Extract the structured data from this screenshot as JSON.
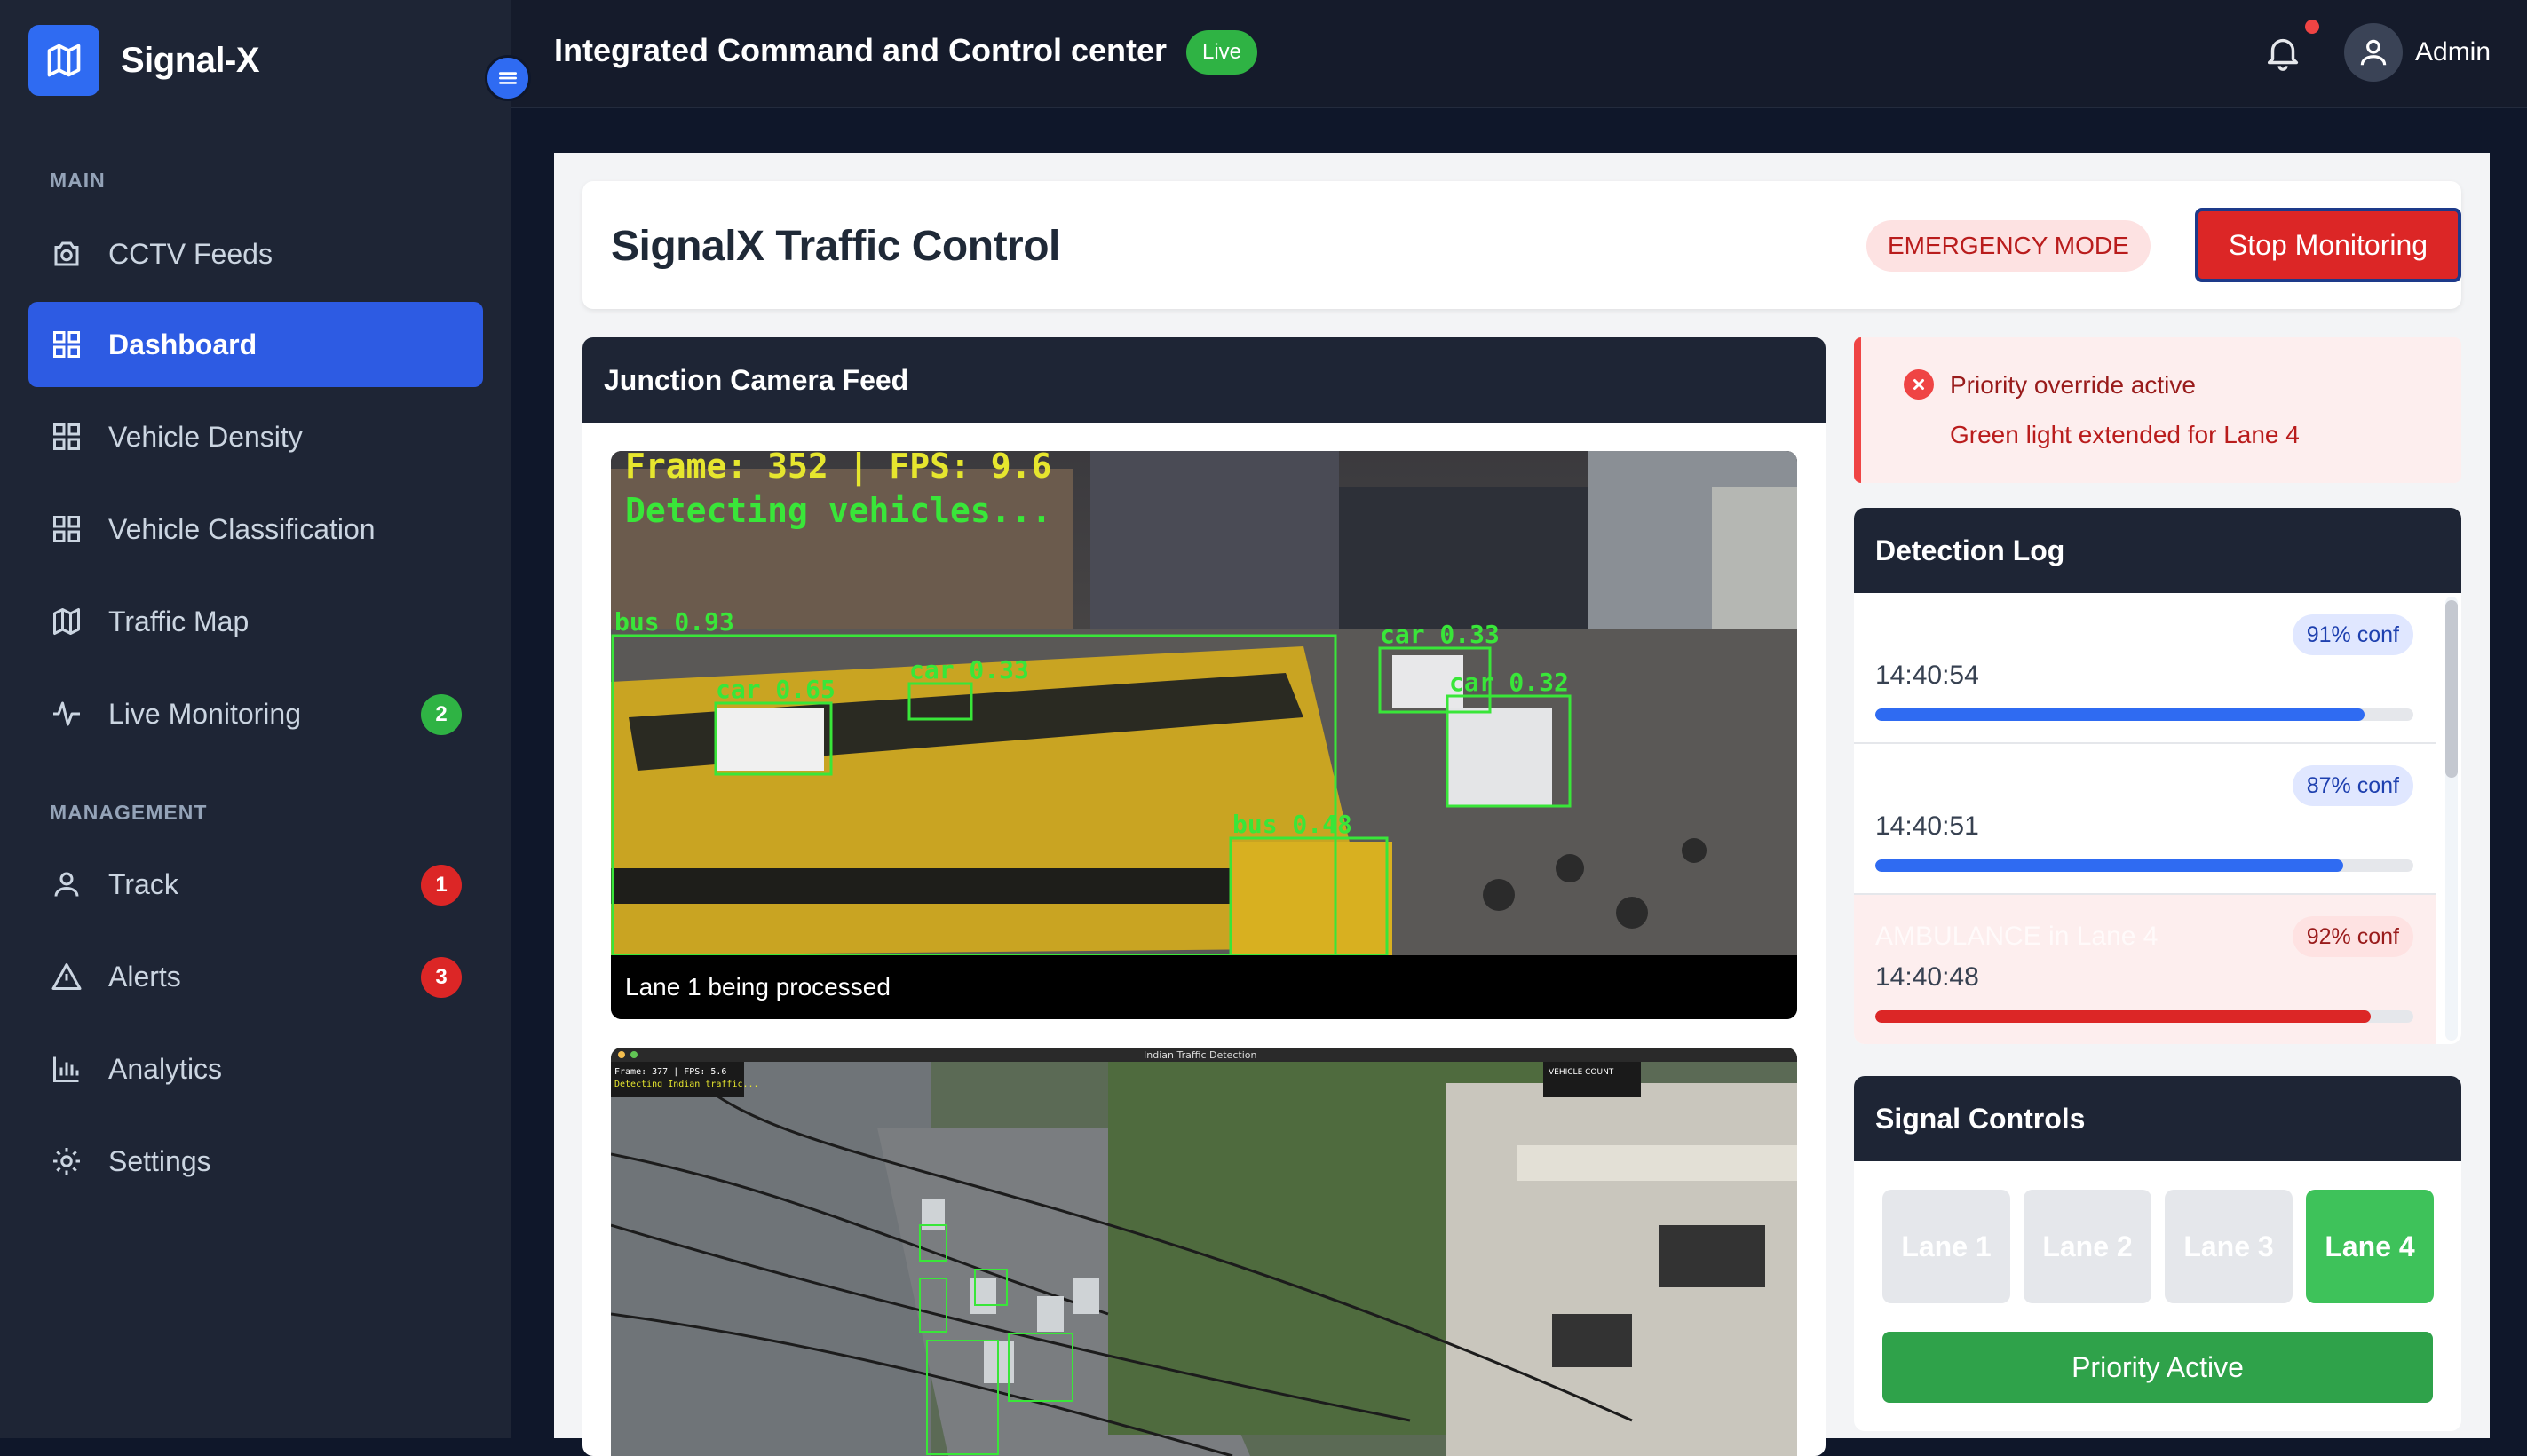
{
  "brand": {
    "name": "Signal-X"
  },
  "sidebar": {
    "section_main": "MAIN",
    "section_management": "MANAGEMENT",
    "items": [
      {
        "label": "CCTV Feeds",
        "icon": "camera-icon"
      },
      {
        "label": "Dashboard",
        "icon": "grid-icon",
        "active": true
      },
      {
        "label": "Vehicle Density",
        "icon": "grid-icon"
      },
      {
        "label": "Vehicle Classification",
        "icon": "grid-icon"
      },
      {
        "label": "Traffic Map",
        "icon": "map-icon"
      },
      {
        "label": "Live Monitoring",
        "icon": "activity-icon",
        "badge": "2"
      },
      {
        "label": "Track",
        "icon": "user-icon",
        "badge": "1"
      },
      {
        "label": "Alerts",
        "icon": "warning-icon",
        "badge": "3"
      },
      {
        "label": "Analytics",
        "icon": "bar-chart-icon"
      },
      {
        "label": "Settings",
        "icon": "gear-icon"
      }
    ]
  },
  "topbar": {
    "title": "Integrated Command and Control center",
    "live_label": "Live",
    "user_name": "Admin"
  },
  "header": {
    "title": "SignalX Traffic Control",
    "emergency_label": "EMERGENCY MODE",
    "stop_label": "Stop Monitoring"
  },
  "camera": {
    "title": "Junction Camera Feed",
    "feed1": {
      "overlay_frame": "Frame: 352 | FPS: 9.6",
      "overlay_status": "Detecting vehicles...",
      "caption": "Lane 1 being processed",
      "detections": [
        "bus 0.93",
        "car 0.65",
        "car 0.33",
        "car 0.33",
        "car 0.32",
        "bus 0.48"
      ]
    },
    "feed2": {
      "overlay_frame": "Frame: 377 | FPS: 5.6",
      "overlay_status": "Detecting Indian traffic...",
      "window_title": "Indian Traffic Detection",
      "count_label": "VEHICLE COUNT"
    }
  },
  "alert": {
    "title": "Priority override active",
    "subtitle": "Green light extended for Lane 4"
  },
  "detection_log": {
    "title": "Detection Log",
    "entries": [
      {
        "time": "14:40:54",
        "conf_label": "91% conf",
        "confidence": 0.91,
        "critical": false,
        "text": ""
      },
      {
        "time": "14:40:51",
        "conf_label": "87% conf",
        "confidence": 0.87,
        "critical": false,
        "text": ""
      },
      {
        "time": "14:40:48",
        "conf_label": "92% conf",
        "confidence": 0.92,
        "critical": true,
        "text": "AMBULANCE in Lane 4"
      }
    ]
  },
  "signal_controls": {
    "title": "Signal Controls",
    "lanes": [
      "Lane 1",
      "Lane 2",
      "Lane 3",
      "Lane 4"
    ],
    "active_lane": "Lane 4",
    "priority_label": "Priority Active"
  },
  "colors": {
    "accent": "#2d5be3",
    "danger": "#dc2626",
    "success": "#2fb344",
    "sidebar_bg": "#1e2535"
  }
}
